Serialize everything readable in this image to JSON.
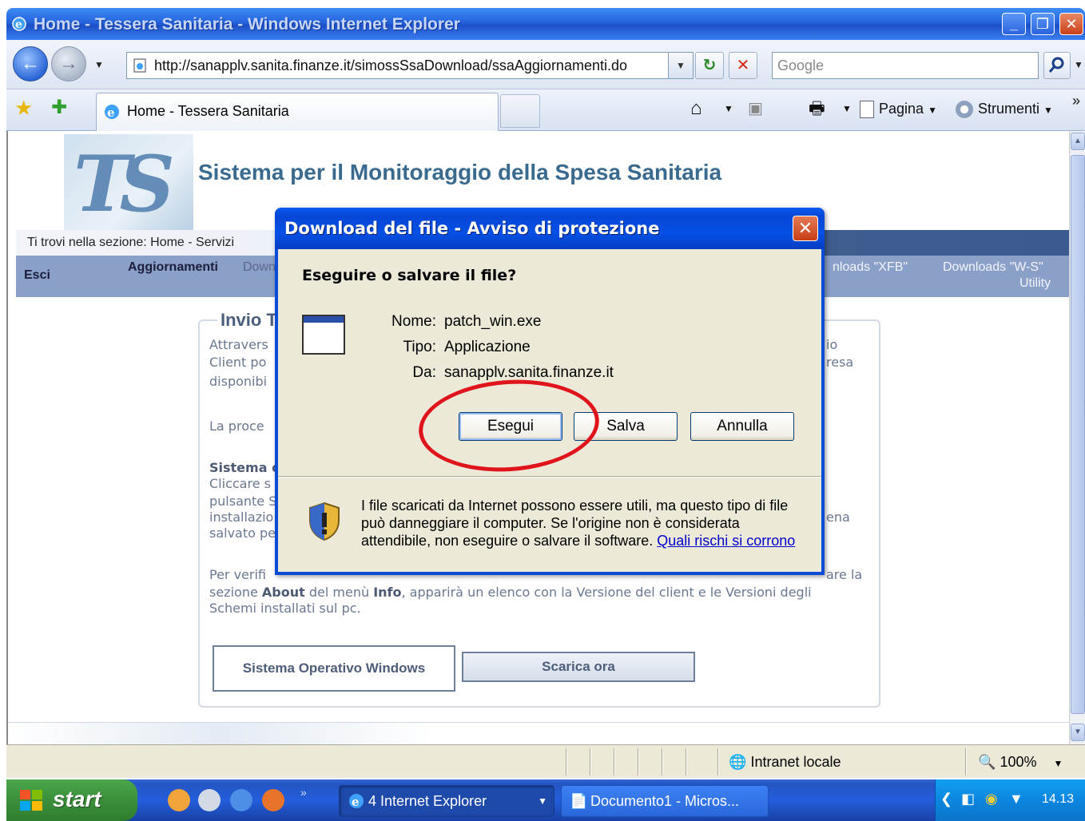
{
  "window": {
    "title": "Home - Tessera Sanitaria - Windows Internet Explorer",
    "min_label": "_",
    "max_label": "❐",
    "close_label": "✕"
  },
  "toolbar": {
    "back_glyph": "←",
    "forward_glyph": "→",
    "url": "http://sanapplv.sanita.finanze.it/simossSsaDownload/ssaAggiornamenti.do",
    "refresh_glyph": "↻",
    "stop_glyph": "✕",
    "search_placeholder": "Google",
    "tab_title": "Home - Tessera Sanitaria",
    "page_menu": "Pagina",
    "tools_menu": "Strumenti",
    "more_glyph": "»"
  },
  "page": {
    "site_title": "Sistema per il Monitoraggio della Spesa Sanitaria",
    "breadcrumb": "Ti trovi nella sezione: Home - Servizi",
    "menu": {
      "esci": "Esci",
      "aggiornamenti": "Aggiornamenti",
      "downl": "Downl",
      "xfb": "nloads \"XFB\"",
      "ws_line1": "Downloads \"W-S\"",
      "ws_line2": "Utility"
    },
    "section_title": "Invio T",
    "left_text": {
      "l1": "Attravers",
      "l2": "Client po",
      "l3": "disponibi",
      "l4": "La proce",
      "l5": "Sistema o",
      "l6": "Cliccare s",
      "l7": "pulsante S",
      "l8": "installazio",
      "l9": "salvato pe"
    },
    "right_text": {
      "r1": "io",
      "r2": "resa",
      "r3": "ena"
    },
    "verify_text": {
      "line1_start": "Per verifi",
      "line1_end": "are la",
      "line2_a": "sezione ",
      "line2_about": "About",
      "line2_b": " del menù ",
      "line2_info": "Info",
      "line2_c": ", apparirà un elenco con la Versione del client e le Versioni degli",
      "line3": "Schemi installati sul pc."
    },
    "os_label": "Sistema Operativo Windows",
    "download_now": "Scarica ora"
  },
  "statusbar": {
    "zone": "Intranet locale",
    "zoom": "100%"
  },
  "taskbar": {
    "start": "start",
    "ie_group": "4 Internet Explorer",
    "word_item": "Documento1 - Micros...",
    "clock": "14.13"
  },
  "dialog": {
    "title": "Download del file - Avviso di protezione",
    "question": "Eseguire o salvare il file?",
    "name_label": "Nome:",
    "name_value": "patch_win.exe",
    "type_label": "Tipo:",
    "type_value": "Applicazione",
    "from_label": "Da:",
    "from_value": "sanapplv.sanita.finanze.it",
    "run_button": "Esegui",
    "save_button": "Salva",
    "cancel_button": "Annulla",
    "warning_text": "I file scaricati da Internet possono essere utili, ma questo tipo di file può danneggiare il computer. Se l'origine non è considerata attendibile, non eseguire o salvare il software.",
    "risk_link": "Quali rischi si corrono"
  },
  "colors": {
    "annotation_circle": "#e0141b",
    "xp_blue": "#0a4bd6"
  }
}
